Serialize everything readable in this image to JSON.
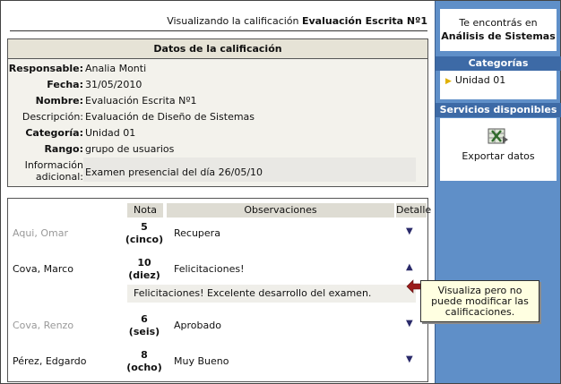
{
  "heading": {
    "prefix": "Visualizando la calificación",
    "name": "Evaluación Escrita Nº1"
  },
  "details": {
    "title": "Datos de la calificación",
    "rows": [
      {
        "label": "Responsable:",
        "value": "Analia Monti"
      },
      {
        "label": "Fecha:",
        "value": "31/05/2010"
      },
      {
        "label": "Nombre:",
        "value": "Evaluación Escrita Nº1"
      },
      {
        "label": "Descripción:",
        "value": "Evaluación de Diseño de Sistemas"
      },
      {
        "label": "Categoría:",
        "value": "Unidad 01"
      },
      {
        "label": "Rango:",
        "value": "grupo de usuarios"
      }
    ],
    "info_label_1": "Información",
    "info_label_2": "adicional:",
    "info_value": "Examen presencial del día 26/05/10"
  },
  "grades": {
    "headers": {
      "note": "Nota",
      "obs": "Observaciones",
      "detail": "Detalle"
    },
    "rows": [
      {
        "name": "Aqui, Omar",
        "n1": "5",
        "n2": "(cinco)",
        "obs": "Recupera"
      },
      {
        "name": "Cova, Marco",
        "n1": "10",
        "n2": "(diez)",
        "obs": "Felicitaciones!"
      },
      {
        "name": "Cova, Renzo",
        "n1": "6",
        "n2": "(seis)",
        "obs": "Aprobado"
      },
      {
        "name": "Pérez, Edgardo",
        "n1": "8",
        "n2": "(ocho)",
        "obs": "Muy Bueno"
      }
    ],
    "detail_text": "Felicitaciones! Excelente desarrollo del examen."
  },
  "sidebar": {
    "location_line": "Te encontrás en",
    "location_name": "Análisis de Sistemas",
    "categories_title": "Categorías",
    "category_item": "Unidad 01",
    "services_title": "Servicios disponibles",
    "export_label": "Exportar datos"
  },
  "tooltip": {
    "line1": "Visualiza pero no",
    "line2": "puede modificar las",
    "line3": "calificaciones."
  },
  "colors": {
    "sidebar": "#5f8fc8",
    "sidebar_header": "#3d6aa6",
    "callout_arrow": "#9b1c1c",
    "tooltip_bg": "#ffffe1"
  }
}
